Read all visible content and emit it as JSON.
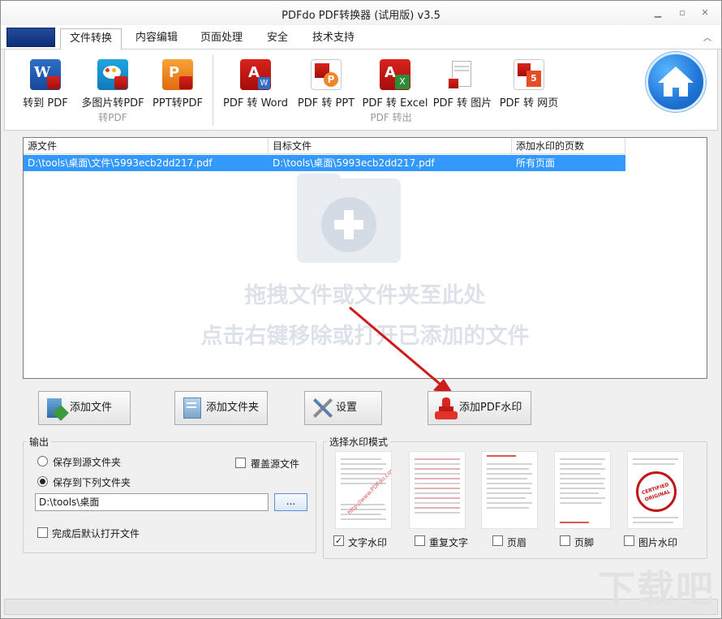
{
  "window": {
    "title": "PDFdo  PDF转换器  (试用版) v3.5"
  },
  "tabs": [
    {
      "label": "文件转换",
      "active": true
    },
    {
      "label": "内容编辑"
    },
    {
      "label": "页面处理"
    },
    {
      "label": "安全"
    },
    {
      "label": "技术支持"
    }
  ],
  "ribbon": {
    "to_pdf": {
      "group_label": "转PDF",
      "buttons": [
        {
          "label": "转到 PDF",
          "icon": "word-to-pdf-icon"
        },
        {
          "label": "多图片转PDF",
          "icon": "images-to-pdf-icon"
        },
        {
          "label": "PPT转PDF",
          "icon": "ppt-to-pdf-icon"
        }
      ]
    },
    "from_pdf": {
      "group_label": "PDF 转出",
      "buttons": [
        {
          "label": "PDF 转 Word",
          "icon": "pdf-to-word-icon"
        },
        {
          "label": "PDF 转 PPT",
          "icon": "pdf-to-ppt-icon"
        },
        {
          "label": "PDF 转 Excel",
          "icon": "pdf-to-excel-icon"
        },
        {
          "label": "PDF 转 图片",
          "icon": "pdf-to-image-icon"
        },
        {
          "label": "PDF 转 网页",
          "icon": "pdf-to-html-icon"
        }
      ]
    },
    "home_icon": "home-icon"
  },
  "file_list": {
    "columns": [
      "源文件",
      "目标文件",
      "添加水印的页数"
    ],
    "rows": [
      {
        "source": "D:\\tools\\桌面\\文件\\5993ecb2dd217.pdf",
        "target": "D:\\tools\\桌面\\5993ecb2dd217.pdf",
        "pages": "所有页面",
        "selected": true
      }
    ],
    "hint_line1": "拖拽文件或文件夹至此处",
    "hint_line2": "点击右键移除或打开已添加的文件"
  },
  "actions": {
    "add_file": "添加文件",
    "add_folder": "添加文件夹",
    "settings": "设置",
    "add_watermark": "添加PDF水印"
  },
  "output": {
    "group_label": "输出",
    "save_to_source": "保存到源文件夹",
    "save_to_source_selected": false,
    "save_to_folder": "保存到下列文件夹",
    "save_to_folder_selected": true,
    "overwrite_source": "覆盖源文件",
    "overwrite_checked": false,
    "folder_path": "D:\\tools\\桌面",
    "browse_label": "...",
    "open_after": "完成后默认打开文件",
    "open_after_checked": false
  },
  "watermark_mode": {
    "group_label": "选择水印模式",
    "options": [
      {
        "label": "文字水印",
        "checked": true
      },
      {
        "label": "重复文字",
        "checked": false
      },
      {
        "label": "页眉",
        "checked": false
      },
      {
        "label": "页脚",
        "checked": false
      },
      {
        "label": "图片水印",
        "checked": false
      }
    ],
    "sample_url": "http://www.PDFdo.com",
    "stamp_text": "CERTIFIED ORIGINAL"
  },
  "colors": {
    "selection": "#3399ff",
    "arrow": "#d01b1b",
    "app_tab": "#1a3f8c"
  }
}
